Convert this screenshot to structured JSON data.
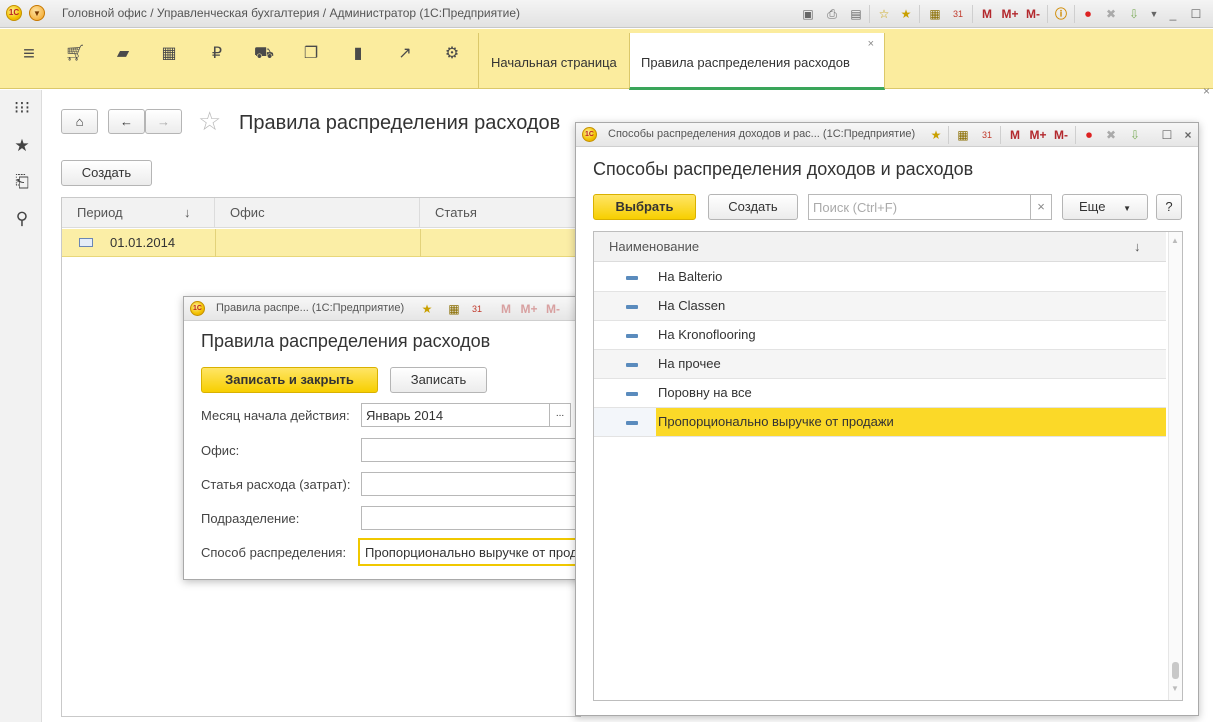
{
  "app": {
    "title": "Головной офис / Управленческая бухгалтерия / Администратор  (1С:Предприятие)",
    "logo_text": "1С"
  },
  "sections": {
    "tabs": [
      {
        "label": "Начальная страница"
      },
      {
        "label": "Правила распределения расходов"
      }
    ],
    "close_glyph": "×"
  },
  "main": {
    "title": "Правила распределения расходов",
    "create_label": "Создать",
    "columns": [
      "Период",
      "Офис",
      "Статья"
    ],
    "sort_glyph": "↓",
    "rows": [
      {
        "period": "01.01.2014",
        "office": "",
        "article": ""
      }
    ]
  },
  "form_dialog": {
    "window_title": "Правила распре...   (1С:Предприятие)",
    "title": "Правила распределения расходов",
    "save_close_label": "Записать и закрыть",
    "save_label": "Записать",
    "fields": {
      "month_label": "Месяц начала действия:",
      "month_value": "Январь 2014",
      "ellipsis": "...",
      "office_label": "Офис:",
      "article_label": "Статья расхода (затрат):",
      "dept_label": "Подразделение:",
      "method_label": "Способ распределения:",
      "method_value": "Пропорционально выручке от продажи"
    }
  },
  "select_dialog": {
    "window_title": "Способы распределения доходов и рас...   (1С:Предприятие)",
    "title": "Способы распределения доходов и расходов",
    "select_label": "Выбрать",
    "create_label": "Создать",
    "search_placeholder": "Поиск (Ctrl+F)",
    "clear_glyph": "×",
    "more_label": "Еще",
    "help_label": "?",
    "column": "Наименование",
    "sort_glyph": "↓",
    "items": [
      {
        "label": "На Balterio"
      },
      {
        "label": "На Classen"
      },
      {
        "label": "На Kronoflooring"
      },
      {
        "label": "На прочее"
      },
      {
        "label": "Поровну на все"
      },
      {
        "label": "Пропорционально выручке от продажи"
      }
    ],
    "selected_index": 5
  },
  "colors": {
    "section_bar": "#fbec9e",
    "accent_yellow": "#f7cf00",
    "active_tab_underline": "#3aa55a",
    "selected_row": "#fbd928"
  }
}
